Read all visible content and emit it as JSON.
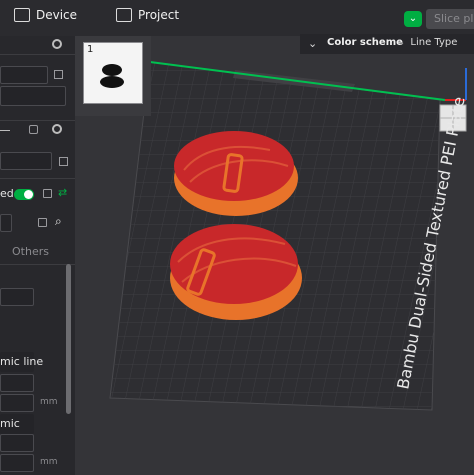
{
  "topbar": {
    "tabs": [
      {
        "label": "Device",
        "icon": "device-icon"
      },
      {
        "label": "Project",
        "icon": "project-icon"
      }
    ],
    "slice_label": "Slice pla"
  },
  "sidebar": {
    "toggle_label": "ed",
    "tab_label": "Others",
    "field_labels": [
      "mic line",
      "mic"
    ],
    "unit": "mm"
  },
  "plate": {
    "number": "1",
    "name": "Bambu Dual-Sided Textured PEI Plate",
    "colors": {
      "bed": "#2e2e31",
      "grid": "#3d3d41",
      "object_top": "#c8282a",
      "object_side": "#e8732a",
      "axis_x": "#e02020",
      "axis_y": "#00c050",
      "axis_z": "#2a6bd8"
    }
  },
  "view": {
    "color_scheme_label": "Color scheme",
    "color_scheme_value": "Line Type"
  }
}
